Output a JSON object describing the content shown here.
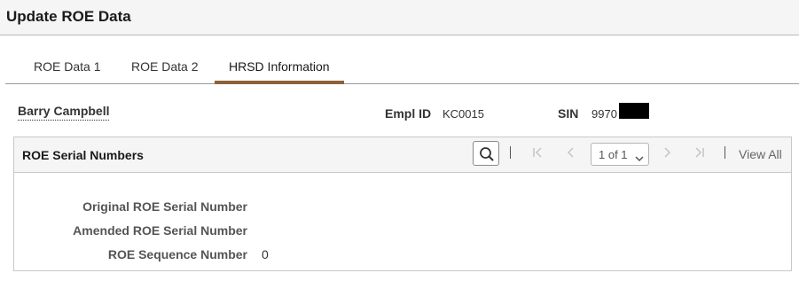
{
  "page": {
    "title": "Update ROE Data"
  },
  "tabs": [
    {
      "label": "ROE Data 1",
      "active": false
    },
    {
      "label": "ROE Data 2",
      "active": false
    },
    {
      "label": "HRSD Information",
      "active": true
    }
  ],
  "employee": {
    "name": "Barry Campbell",
    "empl_id_label": "Empl ID",
    "empl_id": "KC0015",
    "sin_label": "SIN",
    "sin_visible": "9970"
  },
  "grid": {
    "title": "ROE Serial Numbers",
    "pagination": "1 of 1",
    "view_all": "View All"
  },
  "fields": [
    {
      "label": "Original ROE Serial Number",
      "value": ""
    },
    {
      "label": "Amended ROE Serial Number",
      "value": ""
    },
    {
      "label": "ROE Sequence Number",
      "value": "0"
    }
  ],
  "colors": {
    "tab_accent": "#8c6239",
    "header_bg": "#f5f5f5"
  }
}
